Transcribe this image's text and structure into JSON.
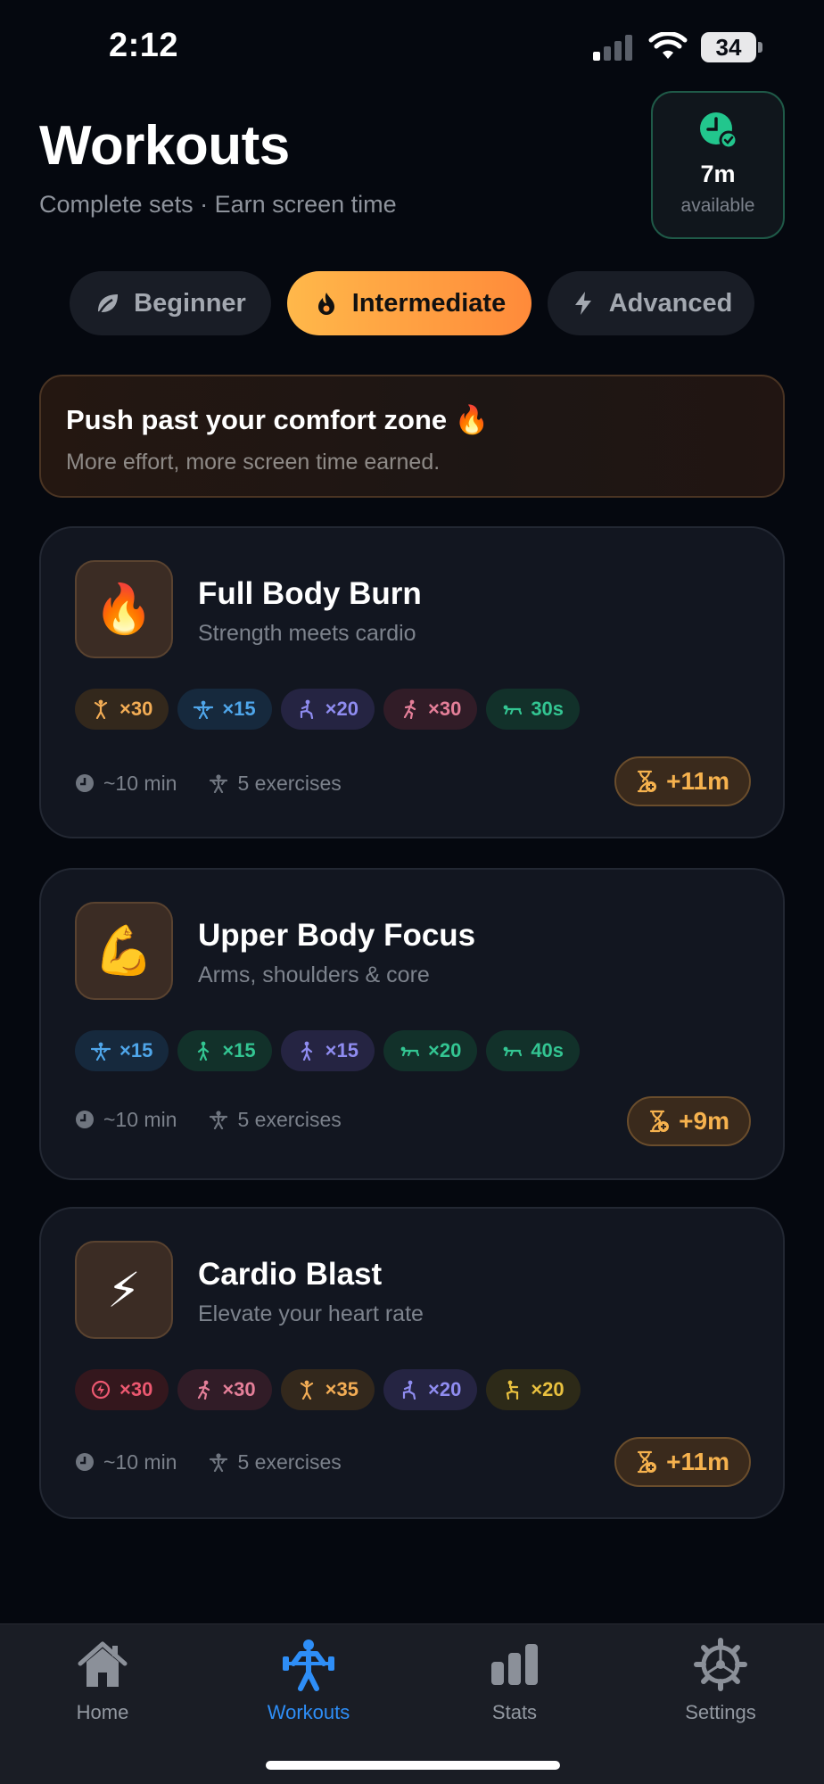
{
  "status_bar": {
    "time": "2:12",
    "battery": "34"
  },
  "header": {
    "title": "Workouts",
    "subtitle": "Complete sets · Earn screen time",
    "time_card": {
      "value": "7m",
      "caption": "available",
      "icon": "clock-check-icon"
    }
  },
  "levels": [
    {
      "label": "Beginner",
      "icon": "leaf-icon",
      "active": false
    },
    {
      "label": "Intermediate",
      "icon": "flame-icon",
      "active": true
    },
    {
      "label": "Advanced",
      "icon": "bolt-icon",
      "active": false
    }
  ],
  "banner": {
    "title": "Push past your comfort zone 🔥",
    "subtitle": "More effort, more screen time earned."
  },
  "workouts": [
    {
      "emoji": "🔥",
      "name": "Full Body Burn",
      "description": "Strength meets cardio",
      "chips": [
        {
          "label": "×30",
          "color": "orange",
          "icon": "jumping-jack-icon"
        },
        {
          "label": "×15",
          "color": "blue",
          "icon": "weightlifter-icon"
        },
        {
          "label": "×20",
          "color": "purple",
          "icon": "lunge-icon"
        },
        {
          "label": "×30",
          "color": "pink",
          "icon": "runner-icon"
        },
        {
          "label": "30s",
          "color": "green",
          "icon": "plank-icon"
        }
      ],
      "duration": "~10 min",
      "exercises": "5 exercises",
      "reward": "+11m"
    },
    {
      "emoji": "💪",
      "name": "Upper Body Focus",
      "description": "Arms, shoulders & core",
      "chips": [
        {
          "label": "×15",
          "color": "blue",
          "icon": "weightlifter-icon"
        },
        {
          "label": "×15",
          "color": "green",
          "icon": "standing-person-icon"
        },
        {
          "label": "×15",
          "color": "purple",
          "icon": "standing-person-icon"
        },
        {
          "label": "×20",
          "color": "green",
          "icon": "plank-icon"
        },
        {
          "label": "40s",
          "color": "green",
          "icon": "plank-icon"
        }
      ],
      "duration": "~10 min",
      "exercises": "5 exercises",
      "reward": "+9m"
    },
    {
      "emoji": "⚡",
      "name": "Cardio Blast",
      "description": "Elevate your heart rate",
      "chips": [
        {
          "label": "×30",
          "color": "red",
          "icon": "speed-circle-icon"
        },
        {
          "label": "×30",
          "color": "pink",
          "icon": "runner-icon"
        },
        {
          "label": "×35",
          "color": "orange",
          "icon": "jumping-jack-icon"
        },
        {
          "label": "×20",
          "color": "purple",
          "icon": "lunge-icon"
        },
        {
          "label": "×20",
          "color": "yellow",
          "icon": "squat-icon"
        }
      ],
      "duration": "~10 min",
      "exercises": "5 exercises",
      "reward": "+11m"
    }
  ],
  "tabbar": [
    {
      "label": "Home",
      "icon": "house-icon",
      "active": false
    },
    {
      "label": "Workouts",
      "icon": "weightlifter-icon",
      "active": true
    },
    {
      "label": "Stats",
      "icon": "bar-chart-icon",
      "active": false
    },
    {
      "label": "Settings",
      "icon": "gear-icon",
      "active": false
    }
  ],
  "colors": {
    "accent": "#ff9a3c",
    "tab_active": "#2e8ef7",
    "available_green": "#22c68d",
    "background": "#05080f"
  }
}
